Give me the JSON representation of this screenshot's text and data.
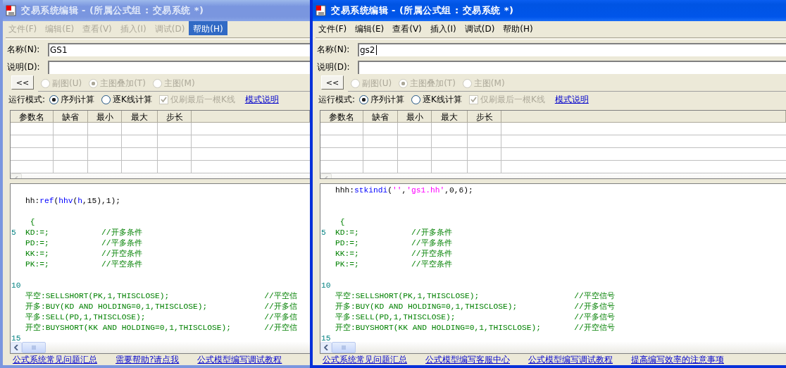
{
  "windows": [
    {
      "active": false,
      "title": "交易系统编辑 - (所属公式组 : 交易系统 *)",
      "menu": [
        {
          "label": "文件(F)",
          "selected": false
        },
        {
          "label": "编辑(E)",
          "selected": false
        },
        {
          "label": "查看(V)",
          "selected": false
        },
        {
          "label": "插入(I)",
          "selected": false
        },
        {
          "label": "调试(D)",
          "selected": false
        },
        {
          "label": "帮助(H)",
          "selected": true
        }
      ],
      "name_field": {
        "label": "名称(N):",
        "value": "GS1"
      },
      "description_field": {
        "label": "说明(D):"
      },
      "collapse_button": "<<",
      "chart_types": [
        {
          "label": "副图(U)",
          "selected": false,
          "disabled": true
        },
        {
          "label": "主图叠加(T)",
          "selected": true,
          "disabled": true
        },
        {
          "label": "主图(M)",
          "selected": false,
          "disabled": true
        }
      ],
      "run_mode": {
        "label": "运行模式:",
        "options": [
          {
            "label": "序列计算",
            "selected": true
          },
          {
            "label": "逐K线计算",
            "selected": false
          }
        ],
        "refresh_last_bar": {
          "label": "仅刷最后一根K线",
          "checked": true,
          "disabled": true
        },
        "link": "模式说明"
      },
      "param_table": {
        "columns": [
          "参数名",
          "缺省",
          "最小",
          "最大",
          "步长"
        ]
      },
      "code_lines": [
        {
          "kind": "blank"
        },
        {
          "segments": [
            {
              "kind": "plain",
              "text": "hh:"
            },
            {
              "kind": "func",
              "text": "ref"
            },
            {
              "kind": "plain",
              "text": "("
            },
            {
              "kind": "func",
              "text": "hhv"
            },
            {
              "kind": "plain",
              "text": "("
            },
            {
              "kind": "func",
              "text": "h"
            },
            {
              "kind": "plain",
              "text": ",15),1);"
            }
          ]
        },
        {
          "kind": "blank"
        },
        {
          "segments": [
            {
              "kind": "code",
              "text": " {"
            }
          ]
        },
        {
          "number": "5",
          "segments": [
            {
              "kind": "code",
              "text": "KD:=;           //开多条件"
            }
          ]
        },
        {
          "segments": [
            {
              "kind": "code",
              "text": "PD:=;           //平多条件"
            }
          ]
        },
        {
          "segments": [
            {
              "kind": "code",
              "text": "KK:=;           //开空条件"
            }
          ]
        },
        {
          "segments": [
            {
              "kind": "code",
              "text": "PK:=;           //平空条件"
            }
          ]
        },
        {
          "kind": "blank"
        },
        {
          "number": "10"
        },
        {
          "segments": [
            {
              "kind": "code",
              "text": "平空:SELLSHORT(PK,1,THISCLOSE);                    //平空信"
            }
          ]
        },
        {
          "segments": [
            {
              "kind": "code",
              "text": "开多:BUY(KD AND HOLDING=0,1,THISCLOSE);            //开多信"
            }
          ]
        },
        {
          "segments": [
            {
              "kind": "code",
              "text": "平多:SELL(PD,1,THISCLOSE);                         //平多信"
            }
          ]
        },
        {
          "segments": [
            {
              "kind": "code",
              "text": "开空:BUYSHORT(KK AND HOLDING=0,1,THISCLOSE);       //开空信"
            }
          ]
        },
        {
          "number": "15"
        }
      ],
      "footer_links": [
        "公式系统常见问题汇总",
        "需要帮助?请点我",
        "公式模型编写调试教程"
      ]
    },
    {
      "active": true,
      "title": "交易系统编辑 - (所属公式组 : 交易系统 *)",
      "menu": [
        {
          "label": "文件(F)",
          "selected": false
        },
        {
          "label": "编辑(E)",
          "selected": false
        },
        {
          "label": "查看(V)",
          "selected": false
        },
        {
          "label": "插入(I)",
          "selected": false
        },
        {
          "label": "调试(D)",
          "selected": false
        },
        {
          "label": "帮助(H)",
          "selected": false
        }
      ],
      "name_field": {
        "label": "名称(N):",
        "value": "gs2",
        "focused": true
      },
      "description_field": {
        "label": "说明(D):"
      },
      "collapse_button": "<<",
      "chart_types": [
        {
          "label": "副图(U)",
          "selected": false,
          "disabled": true
        },
        {
          "label": "主图叠加(T)",
          "selected": true,
          "disabled": true
        },
        {
          "label": "主图(M)",
          "selected": false,
          "disabled": true
        }
      ],
      "run_mode": {
        "label": "运行模式:",
        "options": [
          {
            "label": "序列计算",
            "selected": true
          },
          {
            "label": "逐K线计算",
            "selected": false
          }
        ],
        "refresh_last_bar": {
          "label": "仅刷最后一根K线",
          "checked": true,
          "disabled": true
        },
        "link": "模式说明"
      },
      "param_table": {
        "columns": [
          "参数名",
          "缺省",
          "最小",
          "最大",
          "步长"
        ]
      },
      "code_lines": [
        {
          "segments": [
            {
              "kind": "plain",
              "text": "hhh:"
            },
            {
              "kind": "func",
              "text": "stkindi"
            },
            {
              "kind": "plain",
              "text": "("
            },
            {
              "kind": "string",
              "text": "''"
            },
            {
              "kind": "plain",
              "text": ","
            },
            {
              "kind": "string",
              "text": "'gs1.hh'"
            },
            {
              "kind": "plain",
              "text": ",0,6);"
            }
          ]
        },
        {
          "kind": "blank"
        },
        {
          "kind": "blank"
        },
        {
          "segments": [
            {
              "kind": "code",
              "text": " {"
            }
          ]
        },
        {
          "number": "5",
          "segments": [
            {
              "kind": "code",
              "text": "KD:=;           //开多条件"
            }
          ]
        },
        {
          "segments": [
            {
              "kind": "code",
              "text": "PD:=;           //平多条件"
            }
          ]
        },
        {
          "segments": [
            {
              "kind": "code",
              "text": "KK:=;           //开空条件"
            }
          ]
        },
        {
          "segments": [
            {
              "kind": "code",
              "text": "PK:=;           //平空条件"
            }
          ]
        },
        {
          "kind": "blank"
        },
        {
          "number": "10"
        },
        {
          "segments": [
            {
              "kind": "code",
              "text": "平空:SELLSHORT(PK,1,THISCLOSE);                    //平空信号"
            }
          ]
        },
        {
          "segments": [
            {
              "kind": "code",
              "text": "开多:BUY(KD AND HOLDING=0,1,THISCLOSE);            //开多信号"
            }
          ]
        },
        {
          "segments": [
            {
              "kind": "code",
              "text": "平多:SELL(PD,1,THISCLOSE);                         //平多信号"
            }
          ]
        },
        {
          "segments": [
            {
              "kind": "code",
              "text": "开空:BUYSHORT(KK AND HOLDING=0,1,THISCLOSE);       //开空信号"
            }
          ]
        },
        {
          "number": "15"
        }
      ],
      "footer_links": [
        "公式系统常见问题汇总",
        "公式模型编写客服中心",
        "公式模型编写调试教程",
        "提高编写效率的注意事项"
      ]
    }
  ]
}
